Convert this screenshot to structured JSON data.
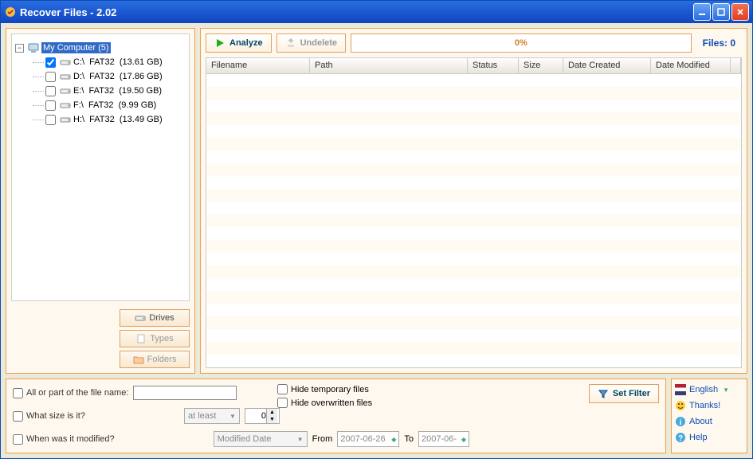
{
  "window": {
    "title": "Recover Files - 2.02"
  },
  "tree": {
    "root": {
      "label": "My Computer (5)"
    },
    "drives": [
      {
        "checked": true,
        "name": "C:\\",
        "fs": "FAT32",
        "size": "(13.61 GB)"
      },
      {
        "checked": false,
        "name": "D:\\",
        "fs": "FAT32",
        "size": "(17.86 GB)"
      },
      {
        "checked": false,
        "name": "E:\\",
        "fs": "FAT32",
        "size": "(19.50 GB)"
      },
      {
        "checked": false,
        "name": "F:\\",
        "fs": "FAT32",
        "size": "(9.99 GB)"
      },
      {
        "checked": false,
        "name": "H:\\",
        "fs": "FAT32",
        "size": "(13.49 GB)"
      }
    ]
  },
  "left_tabs": {
    "drives": "Drives",
    "types": "Types",
    "folders": "Folders"
  },
  "toolbar": {
    "analyze": "Analyze",
    "undelete": "Undelete",
    "progress": "0%",
    "files_label": "Files: 0"
  },
  "columns": {
    "filename": "Filename",
    "path": "Path",
    "status": "Status",
    "size": "Size",
    "datec": "Date Created",
    "datem": "Date Modified"
  },
  "filter": {
    "name_label": "All or part of the file name:",
    "size_label": "What size is it?",
    "modified_label": "When was it modified?",
    "at_least": "at least",
    "spin_value": "0",
    "modified_date": "Modified Date",
    "from": "From",
    "to": "To",
    "date_from": "2007-06-26",
    "date_to": "2007-06-",
    "hide_temp": "Hide temporary files",
    "hide_over": "Hide overwritten files",
    "set_filter": "Set Filter"
  },
  "links": {
    "english": "English",
    "thanks": "Thanks!",
    "about": "About",
    "help": "Help"
  }
}
